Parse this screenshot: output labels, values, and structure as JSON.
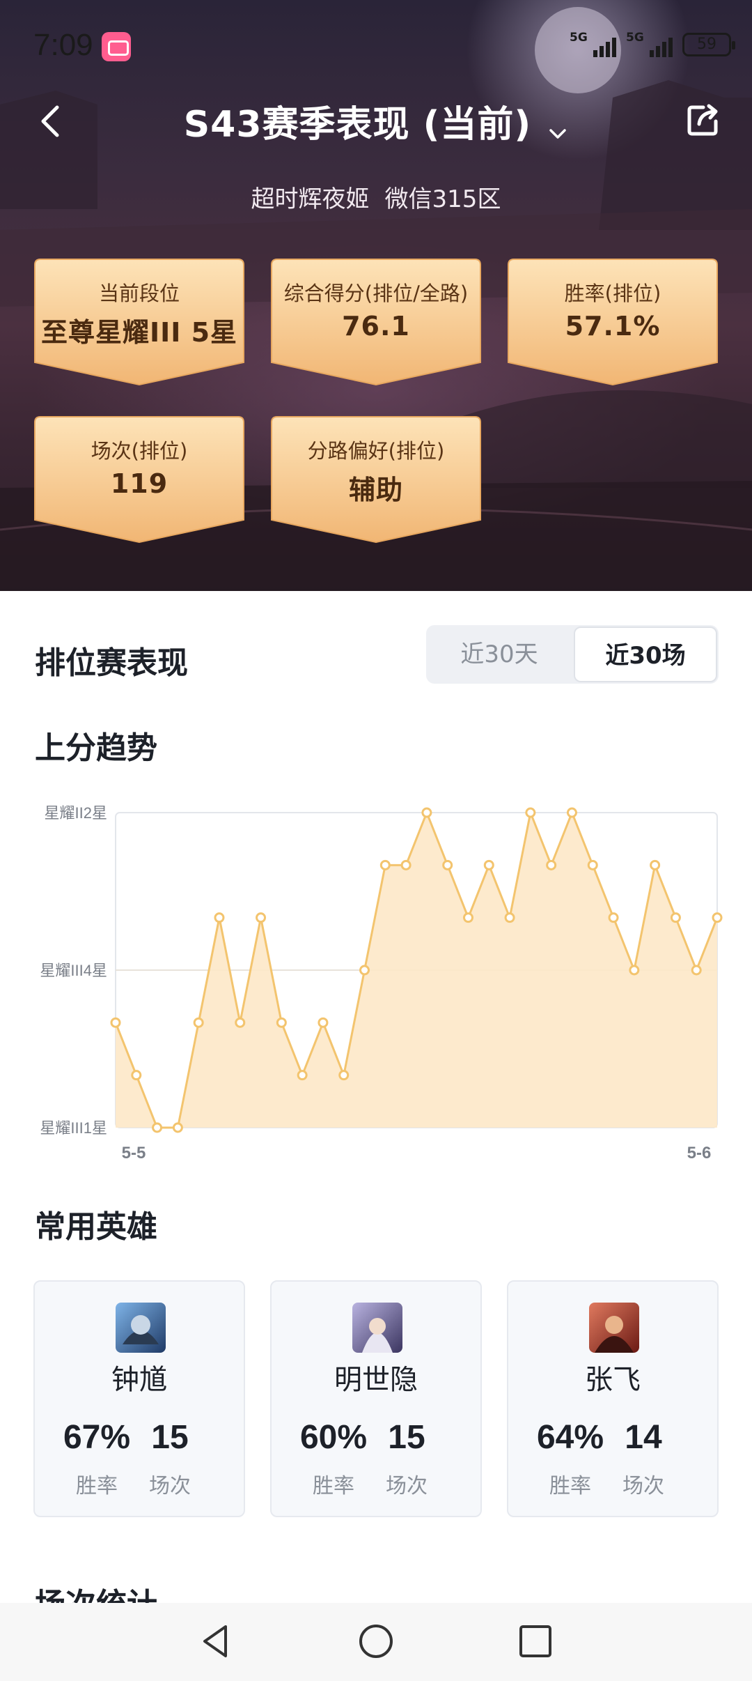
{
  "status_bar": {
    "time": "7:09",
    "signal1": "5G",
    "signal2": "5G",
    "battery": "59"
  },
  "header": {
    "title": "S43赛季表现 (当前)",
    "player_name": "超时辉夜姬",
    "server": "微信315区"
  },
  "stats": [
    {
      "label": "当前段位",
      "value": "至尊星耀III 5星"
    },
    {
      "label": "综合得分(排位/全路)",
      "value": "76.1"
    },
    {
      "label": "胜率(排位)",
      "value": "57.1%"
    },
    {
      "label": "场次(排位)",
      "value": "119"
    },
    {
      "label": "分路偏好(排位)",
      "value": "辅助"
    }
  ],
  "ranked": {
    "title": "排位赛表现",
    "toggle": {
      "option1": "近30天",
      "option2": "近30场",
      "selected": "近30场"
    },
    "trend_title": "上分趋势"
  },
  "chart_data": {
    "type": "area",
    "yticks": [
      "星耀II2星",
      "星耀III4星",
      "星耀III1星"
    ],
    "ylim": [
      "星耀III1星",
      "星耀II2星"
    ],
    "xlabels": [
      "5-5",
      "5-6"
    ],
    "y_ranks": [
      2,
      1,
      0,
      0,
      2,
      4,
      2,
      4,
      2,
      1,
      2,
      1,
      3,
      5,
      5,
      6,
      5,
      4,
      5,
      4,
      6,
      5,
      6,
      5,
      4,
      3,
      5,
      4,
      3,
      4
    ],
    "rank_scale": {
      "0": "星耀III1星",
      "1": "星耀III2星",
      "2": "星耀III3星",
      "3": "星耀III4星",
      "4": "星耀III5星",
      "5": "星耀II1星",
      "6": "星耀II2星"
    },
    "grid": true,
    "colors": {
      "line": "#f3c46e",
      "fill": "#fde8c8"
    }
  },
  "heroes_section": {
    "title": "常用英雄",
    "heroes": [
      {
        "name": "钟馗",
        "win_rate": "67%",
        "win_label": "胜率",
        "games": "15",
        "games_label": "场次",
        "avatar": "zhongkui-avatar"
      },
      {
        "name": "明世隐",
        "win_rate": "60%",
        "win_label": "胜率",
        "games": "15",
        "games_label": "场次",
        "avatar": "mingshiyin-avatar"
      },
      {
        "name": "张飞",
        "win_rate": "64%",
        "win_label": "胜率",
        "games": "14",
        "games_label": "场次",
        "avatar": "zhangfei-avatar"
      }
    ]
  },
  "next_section": {
    "title": "场次统计"
  },
  "system_nav": {
    "back": "back-icon",
    "home": "home-icon",
    "recent": "recent-apps-icon"
  }
}
